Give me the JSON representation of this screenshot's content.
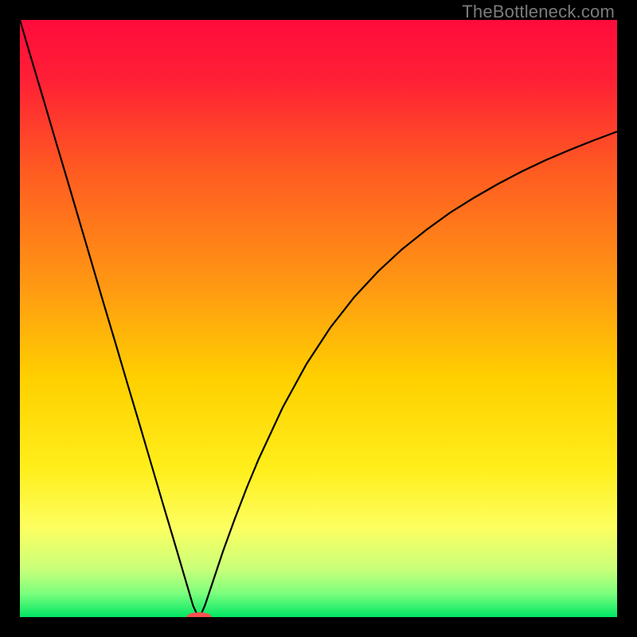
{
  "watermark": "TheBottleneck.com",
  "chart_data": {
    "type": "line",
    "title": "",
    "xlabel": "",
    "ylabel": "",
    "xlim": [
      0,
      100
    ],
    "ylim": [
      0,
      100
    ],
    "grid": false,
    "legend": false,
    "background_gradient_stops": [
      {
        "pos": 0.0,
        "color": "#ff0b3c"
      },
      {
        "pos": 0.1,
        "color": "#ff2035"
      },
      {
        "pos": 0.25,
        "color": "#ff5a22"
      },
      {
        "pos": 0.45,
        "color": "#ff9a12"
      },
      {
        "pos": 0.6,
        "color": "#ffd000"
      },
      {
        "pos": 0.75,
        "color": "#ffee1a"
      },
      {
        "pos": 0.85,
        "color": "#fdff60"
      },
      {
        "pos": 0.92,
        "color": "#c9ff7a"
      },
      {
        "pos": 0.96,
        "color": "#7dff7d"
      },
      {
        "pos": 1.0,
        "color": "#00e765"
      }
    ],
    "series": [
      {
        "name": "bottleneck-curve",
        "stroke": "#000000",
        "stroke_width": 2.2,
        "x": [
          0,
          2,
          4,
          6,
          8,
          10,
          12,
          14,
          16,
          18,
          20,
          22,
          24,
          26,
          28,
          29,
          29.7,
          30,
          30.3,
          31,
          32,
          34,
          36,
          38,
          40,
          44,
          48,
          52,
          56,
          60,
          64,
          68,
          72,
          76,
          80,
          84,
          88,
          92,
          96,
          100
        ],
        "y": [
          100,
          93.2,
          86.5,
          79.7,
          73.0,
          66.2,
          59.4,
          52.6,
          45.9,
          39.1,
          32.4,
          25.6,
          18.8,
          12.1,
          5.3,
          1.9,
          0.4,
          0.0,
          0.4,
          2.0,
          5.0,
          11.0,
          16.5,
          21.7,
          26.5,
          35.1,
          42.4,
          48.5,
          53.6,
          57.9,
          61.6,
          64.8,
          67.7,
          70.2,
          72.5,
          74.6,
          76.5,
          78.2,
          79.8,
          81.3
        ]
      }
    ],
    "optimum_marker": {
      "x": 30,
      "y": 0,
      "color": "#ff4f4f",
      "rx": 2.1,
      "ry": 0.8
    }
  }
}
